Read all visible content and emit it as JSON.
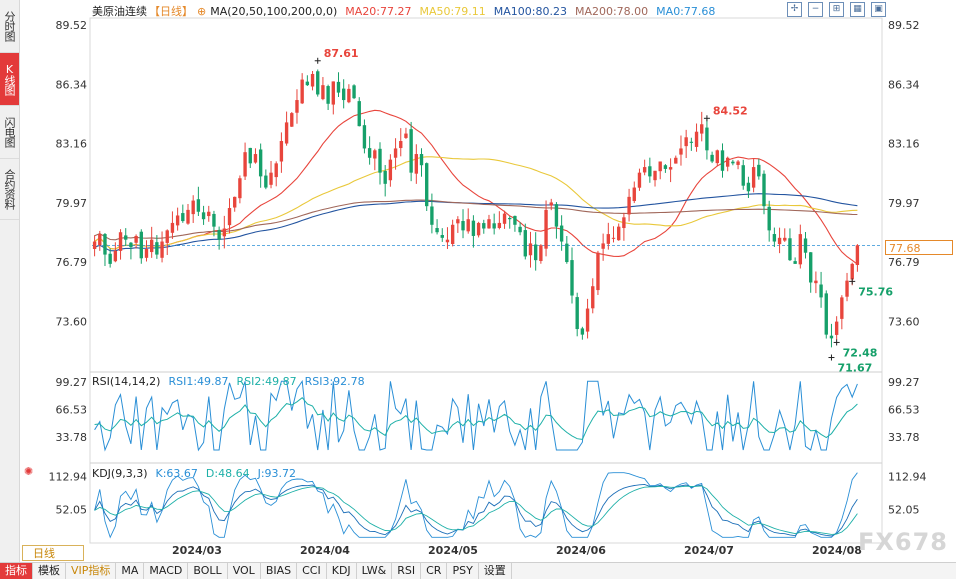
{
  "side_tabs": [
    "分时图",
    "K线图",
    "闪电图",
    "合约资料"
  ],
  "active_side_tab": 1,
  "main_legend": {
    "symbol": "美原油连续",
    "period": "【日线】",
    "ma_label": "MA(20,50,100,200,0,0)",
    "items": [
      {
        "text": "MA20:77.27",
        "color": "#e8453c"
      },
      {
        "text": "MA50:79.11",
        "color": "#e9c83a"
      },
      {
        "text": "MA100:80.23",
        "color": "#2455a0"
      },
      {
        "text": "MA200:78.00",
        "color": "#a0675a"
      },
      {
        "text": "MA0:77.68",
        "color": "#2a8fd6"
      }
    ]
  },
  "rsi_legend": {
    "label": "RSI(14,14,2)",
    "items": [
      {
        "text": "RSI1:49.87",
        "color": "#2a8fd6"
      },
      {
        "text": "RSI2:49.87",
        "color": "#1eb0a8"
      },
      {
        "text": "RSI3:92.78",
        "color": "#2a8fd6"
      }
    ]
  },
  "kdj_legend": {
    "label": "KDJ(9,3,3)",
    "items": [
      {
        "text": "K:63.67",
        "color": "#2a8fd6"
      },
      {
        "text": "D:48.64",
        "color": "#1eb0a8"
      },
      {
        "text": "J:93.72",
        "color": "#2a8fd6"
      }
    ]
  },
  "current_price": "77.68",
  "period_button": "日线",
  "bottom_tabs": [
    "指标",
    "模板",
    "VIP指标",
    "MA",
    "MACD",
    "BOLL",
    "VOL",
    "BIAS",
    "CCI",
    "KDJ",
    "LW&",
    "RSI",
    "CR",
    "PSY",
    "设置"
  ],
  "watermark": "FX678",
  "toolbar_icons": [
    "zoom-in-icon",
    "zoom-out-icon",
    "fullscreen-icon",
    "settings-icon",
    "window-icon"
  ],
  "chart_data": [
    {
      "type": "candlestick",
      "title": "美原油连续【日线】",
      "yticks": [
        "89.52",
        "86.34",
        "83.16",
        "79.97",
        "76.79",
        "73.60"
      ],
      "ylim": [
        71.0,
        89.8
      ],
      "xticks": [
        "2024/03",
        "2024/04",
        "2024/05",
        "2024/06",
        "2024/07",
        "2024/08"
      ],
      "annotations": [
        {
          "text": "87.61",
          "value": 87.61,
          "kind": "high"
        },
        {
          "text": "84.52",
          "value": 84.52,
          "kind": "high"
        },
        {
          "text": "75.76",
          "value": 75.76,
          "kind": "low"
        },
        {
          "text": "72.48",
          "value": 72.48,
          "kind": "low"
        },
        {
          "text": "71.67",
          "value": 71.67,
          "kind": "low"
        }
      ],
      "reference_line": 77.68,
      "closes": [
        77.9,
        78.3,
        77.2,
        76.7,
        77.4,
        78.4,
        78.0,
        77.6,
        78.2,
        77.0,
        77.5,
        78.0,
        77.2,
        77.9,
        78.5,
        78.9,
        79.3,
        79.0,
        79.6,
        80.1,
        79.5,
        79.1,
        79.5,
        78.7,
        78.0,
        78.6,
        79.7,
        80.3,
        81.3,
        82.7,
        82.1,
        82.6,
        81.4,
        80.8,
        81.6,
        82.1,
        83.3,
        84.3,
        84.8,
        85.5,
        86.6,
        86.3,
        86.9,
        85.8,
        86.3,
        85.3,
        86.5,
        85.9,
        85.5,
        86.1,
        85.6,
        84.1,
        82.9,
        82.4,
        82.8,
        81.6,
        81.0,
        82.3,
        82.9,
        83.3,
        83.7,
        81.6,
        82.6,
        82.0,
        79.8,
        78.8,
        78.4,
        78.1,
        78.0,
        78.8,
        79.1,
        78.5,
        79.1,
        78.2,
        78.9,
        78.6,
        79.1,
        78.6,
        78.9,
        79.4,
        79.1,
        78.8,
        78.4,
        77.1,
        77.8,
        76.9,
        77.7,
        79.6,
        80.0,
        78.7,
        77.9,
        76.8,
        75.0,
        73.2,
        72.9,
        74.3,
        75.5,
        77.3,
        77.8,
        78.3,
        78.1,
        78.7,
        79.2,
        80.3,
        80.8,
        81.6,
        81.9,
        81.4,
        81.7,
        82.2,
        81.8,
        81.9,
        82.4,
        82.9,
        83.5,
        83.2,
        83.8,
        84.2,
        82.8,
        82.2,
        82.8,
        81.7,
        82.4,
        82.1,
        82.2,
        80.9,
        80.6,
        81.9,
        81.4,
        79.8,
        78.5,
        77.9,
        78.1,
        78.1,
        76.9,
        76.7,
        78.3,
        77.3,
        75.7,
        75.8,
        74.9,
        72.9,
        72.7,
        73.6,
        74.9,
        75.8,
        76.7,
        77.7
      ]
    },
    {
      "type": "line",
      "title": "RSI(14,14,2)",
      "yticks": [
        "99.27",
        "66.53",
        "33.78"
      ],
      "ylim": [
        12,
        104
      ]
    },
    {
      "type": "line",
      "title": "KDJ(9,3,3)",
      "yticks": [
        "112.94",
        "52.05"
      ],
      "ylim": [
        -5,
        125
      ]
    }
  ]
}
